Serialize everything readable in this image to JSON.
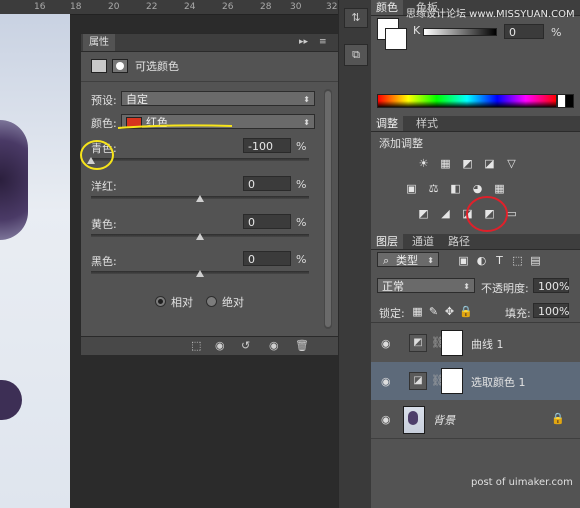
{
  "ruler": {
    "ticks": [
      "16",
      "18",
      "20",
      "22",
      "24",
      "26",
      "28",
      "30",
      "32"
    ]
  },
  "properties": {
    "tab_label": "属性",
    "header_icons": [
      "▸▸",
      "≡"
    ],
    "title": "可选颜色",
    "preset_label": "预设:",
    "preset_value": "自定",
    "color_label": "颜色:",
    "color_value": "红色",
    "color_swatch": "#d6341e",
    "sliders": [
      {
        "label": "青色:",
        "value": "-100",
        "unit": "%",
        "level": 0.0
      },
      {
        "label": "洋红:",
        "value": "0",
        "unit": "%",
        "level": 0.5
      },
      {
        "label": "黄色:",
        "value": "0",
        "unit": "%",
        "level": 0.5
      },
      {
        "label": "黑色:",
        "value": "0",
        "unit": "%",
        "level": 0.5
      }
    ],
    "radio_relative": "相对",
    "radio_absolute": "绝对"
  },
  "color_panel": {
    "tabs": [
      "颜色",
      "色板"
    ],
    "channel_label": "K",
    "channel_value": "0",
    "unit": "%"
  },
  "watermark": "思缘设计论坛 www.MISSYUAN.COM",
  "adjustments": {
    "tabs": [
      "调整",
      "样式"
    ],
    "title": "添加调整",
    "row1": [
      "☀",
      "▦",
      "◩",
      "◪",
      "▽"
    ],
    "row2": [
      "▣",
      "⚖",
      "◧",
      "◕",
      "▦"
    ],
    "row3": [
      "◩",
      "◢",
      "◪",
      "◩",
      "▭"
    ]
  },
  "layers": {
    "tabs": [
      "图层",
      "通道",
      "路径"
    ],
    "kind_value": "类型",
    "blend_mode": "正常",
    "opacity_label": "不透明度:",
    "opacity_value": "100%",
    "lock_label": "锁定:",
    "fill_label": "填充:",
    "fill_value": "100%",
    "items": [
      {
        "name": "曲线 1"
      },
      {
        "name": "选取颜色 1"
      },
      {
        "name": "背景"
      }
    ]
  },
  "footer_credit": "post of uimaker.com"
}
